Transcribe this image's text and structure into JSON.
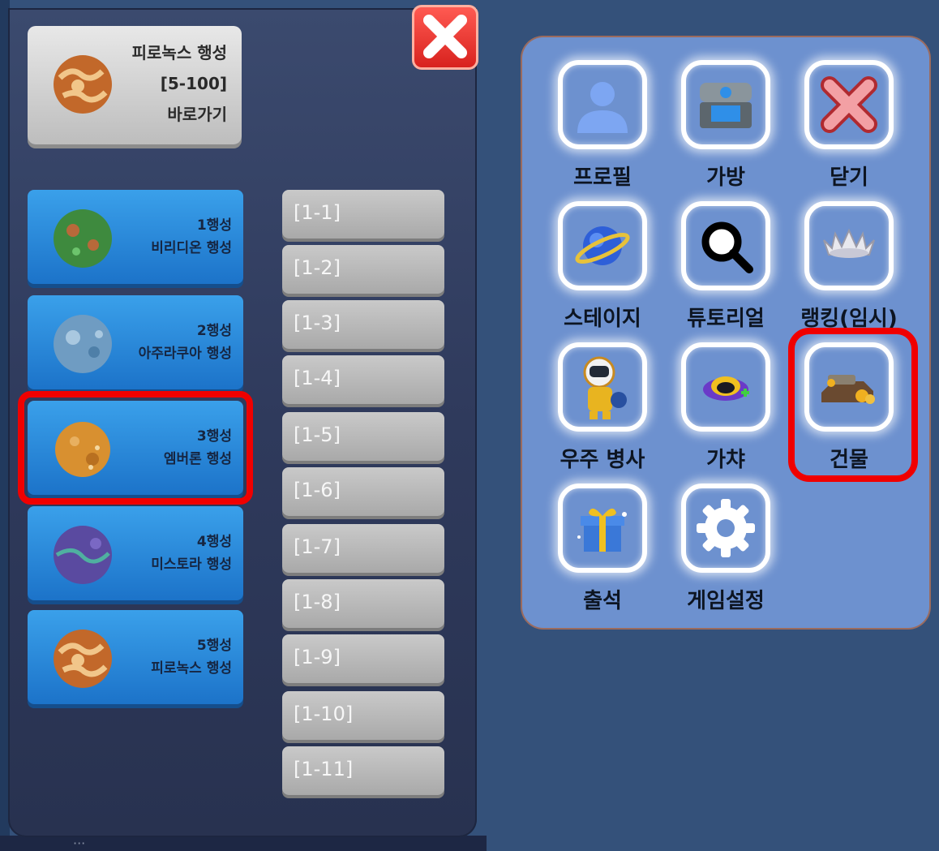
{
  "left_panel": {
    "close_button_icon": "close-x-icon",
    "shortcut": {
      "planet_name": "피로녹스 행성",
      "level_range": "[5-100]",
      "action": "바로가기"
    },
    "planets": [
      {
        "number": "1행성",
        "name": "비리디온 행성",
        "color": "#3e8a3e"
      },
      {
        "number": "2행성",
        "name": "아주라쿠아 행성",
        "color": "#6f9cc2"
      },
      {
        "number": "3행성",
        "name": "엠버론 행성",
        "color": "#d89030"
      },
      {
        "number": "4행성",
        "name": "미스토라 행성",
        "color": "#5a4aa0"
      },
      {
        "number": "5행성",
        "name": "피로녹스 행성",
        "color": "#c2682a"
      }
    ],
    "stages": [
      "[1-1]",
      "[1-2]",
      "[1-3]",
      "[1-4]",
      "[1-5]",
      "[1-6]",
      "[1-7]",
      "[1-8]",
      "[1-9]",
      "[1-10]",
      "[1-11]"
    ]
  },
  "menu": {
    "items": [
      {
        "label": "프로필",
        "icon": "profile-icon"
      },
      {
        "label": "가방",
        "icon": "chest-icon"
      },
      {
        "label": "닫기",
        "icon": "close-icon"
      },
      {
        "label": "스테이지",
        "icon": "planet-icon"
      },
      {
        "label": "튜토리얼",
        "icon": "magnifier-icon"
      },
      {
        "label": "랭킹(임시)",
        "icon": "ranking-icon"
      },
      {
        "label": "우주 병사",
        "icon": "soldier-icon"
      },
      {
        "label": "가챠",
        "icon": "gacha-icon"
      },
      {
        "label": "건물",
        "icon": "building-icon"
      },
      {
        "label": "출석",
        "icon": "gift-icon"
      },
      {
        "label": "게임설정",
        "icon": "gear-icon"
      }
    ]
  },
  "colors": {
    "highlight": "#f00000",
    "menu_panel": "#6d91cf",
    "planet_button": "#2a8ce0"
  }
}
